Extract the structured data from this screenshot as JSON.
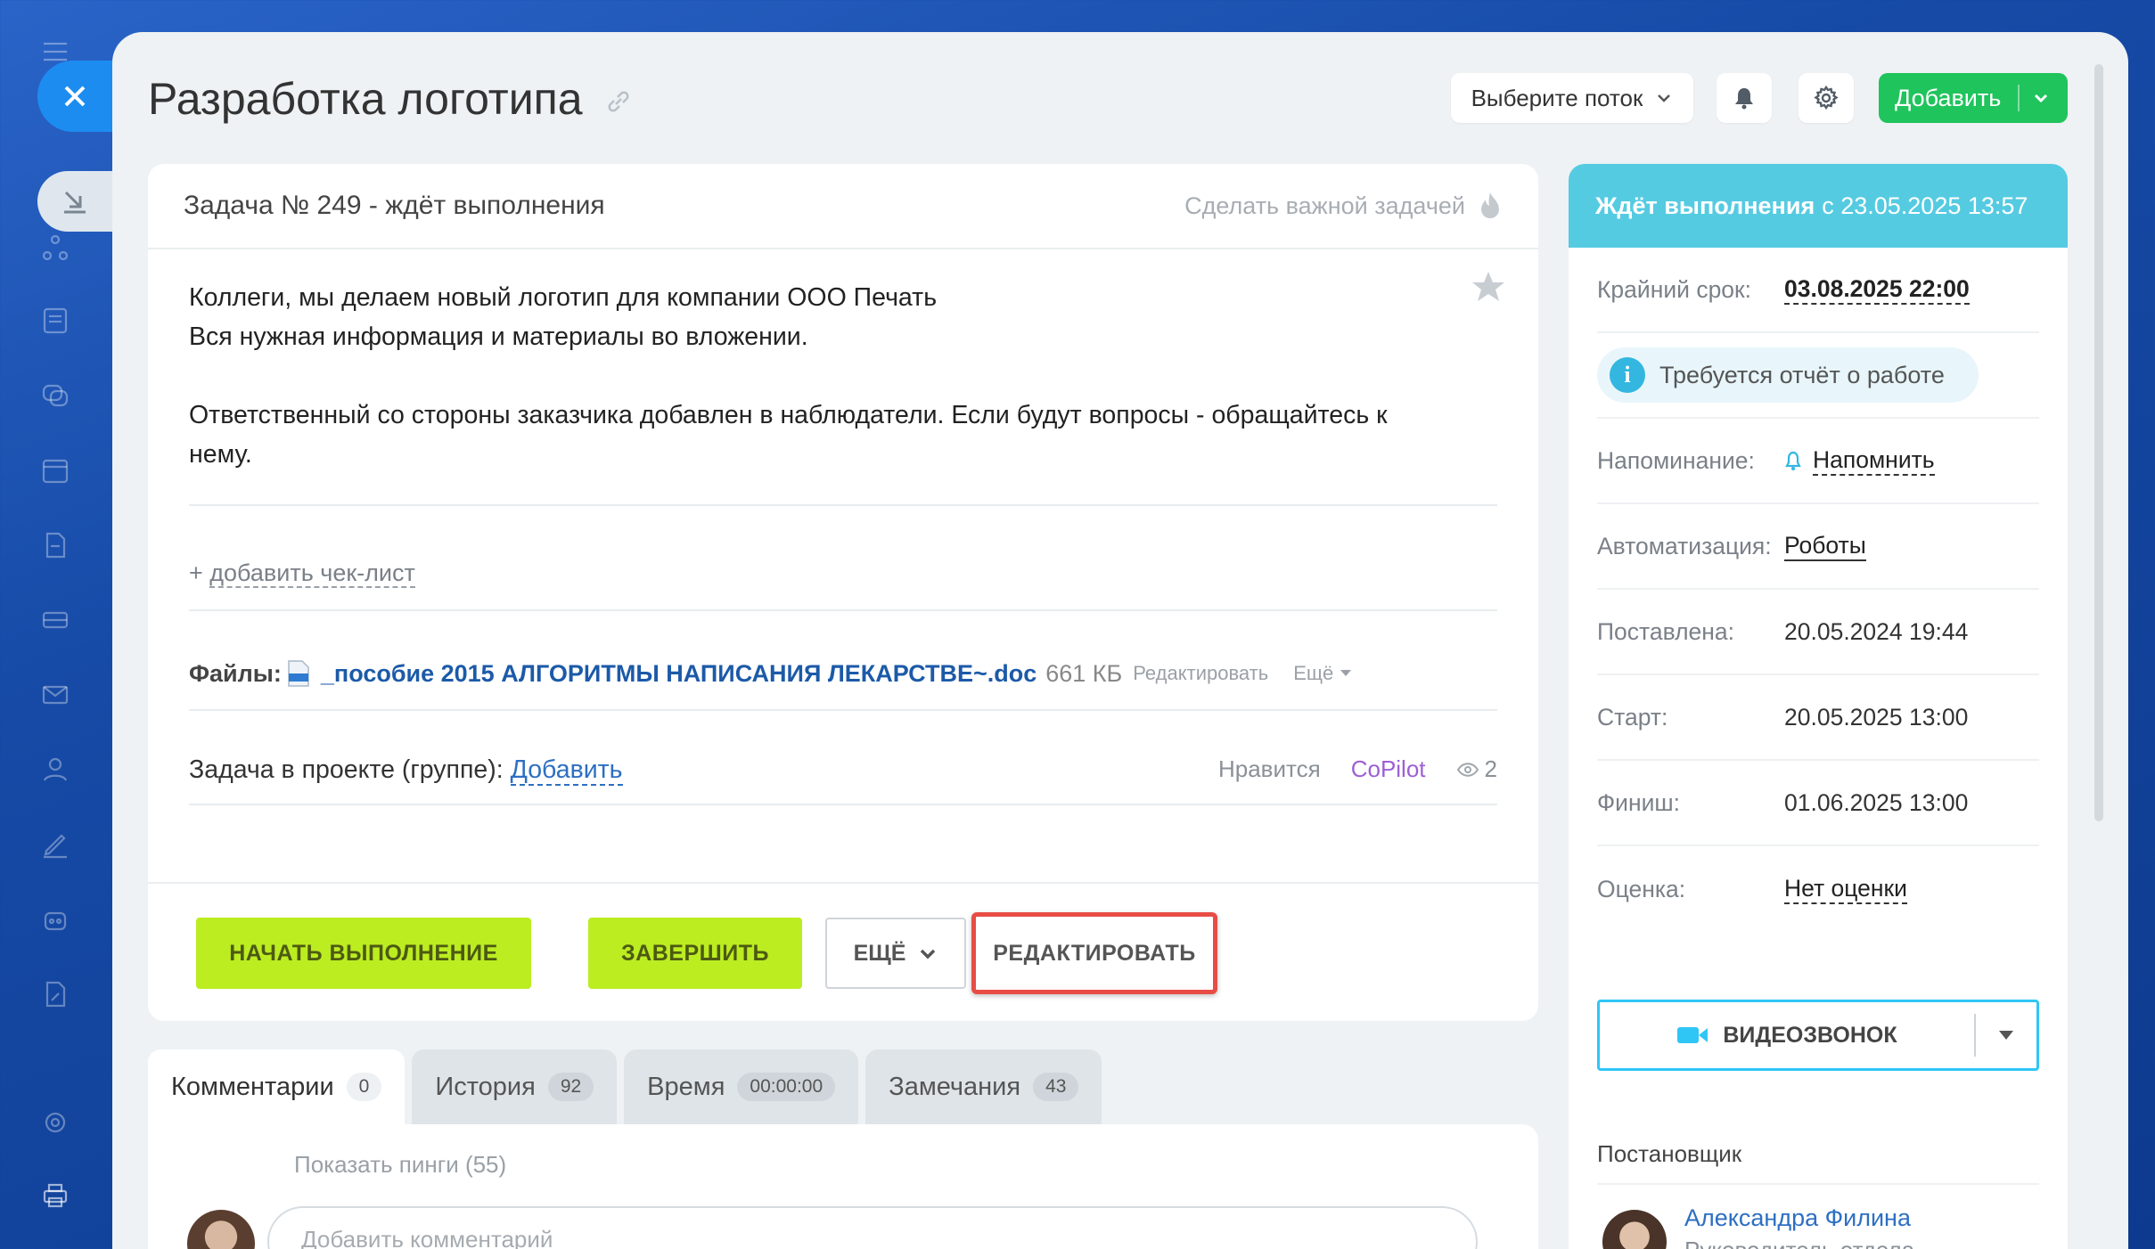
{
  "header": {
    "title": "Разработка логотипа",
    "stream_select": "Выберите поток",
    "add_label": "Добавить"
  },
  "task": {
    "heading": "Задача № 249 - ждёт выполнения",
    "make_important": "Сделать важной задачей",
    "description": [
      "Коллеги, мы делаем новый логотип для компании ООО Печать",
      "Вся нужная информация и материалы во вложении.",
      "",
      "Ответственный со стороны заказчика добавлен в наблюдатели. Если будут вопросы - обращайтесь к",
      "нему."
    ],
    "checklist_prefix": "+ ",
    "checklist_link": "добавить чек-лист",
    "files_label": "Файлы:",
    "file_name": "_пособие 2015 АЛГОРИТМЫ НАПИСАНИЯ ЛЕКАРСТВЕ~.doc",
    "file_size": "661 КБ",
    "file_edit": "Редактировать",
    "file_more": "Ещё",
    "project_label": "Задача в проекте (группе): ",
    "project_link": "Добавить",
    "like": "Нравится",
    "copilot": "CoPilot",
    "views": "2"
  },
  "actions": {
    "start": "НАЧАТЬ ВЫПОЛНЕНИЕ",
    "finish": "ЗАВЕРШИТЬ",
    "more": "ЕЩЁ",
    "edit": "РЕДАКТИРОВАТЬ"
  },
  "tabs": [
    {
      "label": "Комментарии",
      "count": "0"
    },
    {
      "label": "История",
      "count": "92"
    },
    {
      "label": "Время",
      "count": "00:00:00"
    },
    {
      "label": "Замечания",
      "count": "43"
    }
  ],
  "comments": {
    "show_pings": "Показать пинги (55)",
    "placeholder": "Добавить комментарий"
  },
  "status": {
    "bold": "Ждёт выполнения",
    "rest": "с 23.05.2025 13:57"
  },
  "details": {
    "deadline_label": "Крайний срок:",
    "deadline_value": "03.08.2025 22:00",
    "report": "Требуется отчёт о работе",
    "reminder_label": "Напоминание:",
    "reminder_value": "Напомнить",
    "automation_label": "Автоматизация:",
    "automation_value": "Роботы",
    "created_label": "Поставлена:",
    "created_value": "20.05.2024 19:44",
    "start_label": "Старт:",
    "start_value": "20.05.2025 13:00",
    "finish_label": "Финиш:",
    "finish_value": "01.06.2025 13:00",
    "rating_label": "Оценка:",
    "rating_value": "Нет оценки",
    "video_call": "ВИДЕОЗВОНОК"
  },
  "creator": {
    "title": "Постановщик",
    "name": "Александра Филина",
    "position": "Руководитель отдела маркетинга"
  },
  "colors": {
    "status_header": "#55cbe2",
    "green_button": "#bbed21",
    "add_button": "#1fc45c",
    "edit_highlight": "#e84d45"
  }
}
